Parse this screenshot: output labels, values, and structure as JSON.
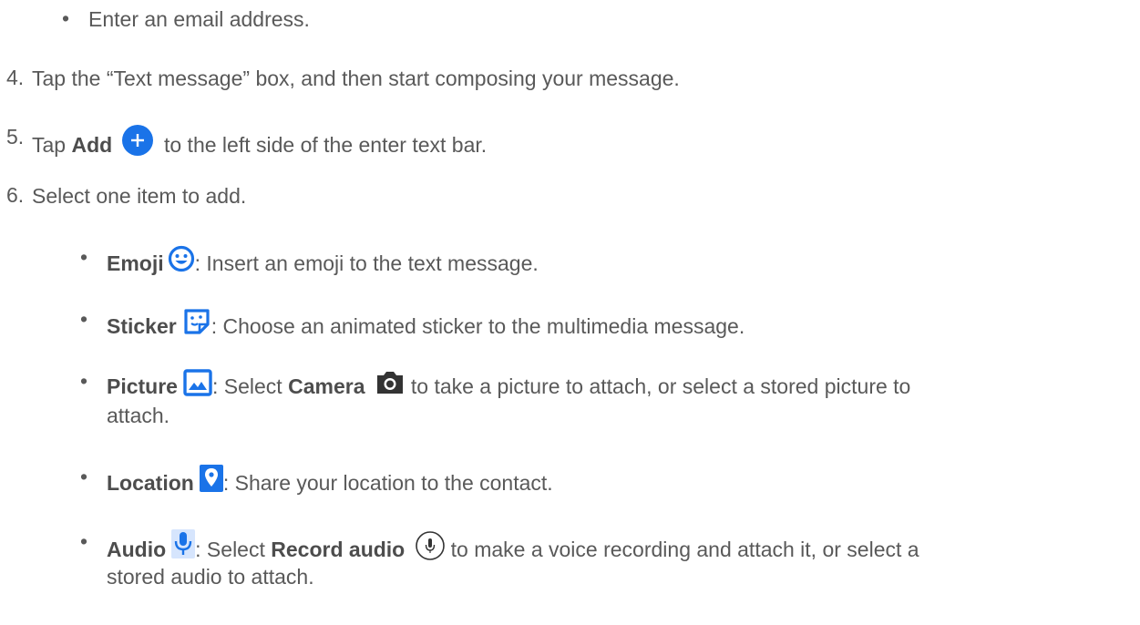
{
  "bullet_char": "•",
  "top_bullet": {
    "text": "Enter an email address."
  },
  "steps": [
    {
      "num": "4.",
      "text": "Tap the “Text message” box, and then start composing your message."
    },
    {
      "num": "5.",
      "pre": "Tap ",
      "bold": "Add",
      "icon": "add-circle-icon",
      "post": "to the left side of the enter text bar."
    },
    {
      "num": "6.",
      "text": "Select one item to add."
    }
  ],
  "items": [
    {
      "bold": "Emoji",
      "icon": "emoji-icon",
      "text": ": Insert an emoji to the text message."
    },
    {
      "bold": "Sticker",
      "icon": "sticker-icon",
      "text": ": Choose an animated sticker to the multimedia message."
    },
    {
      "bold": "Picture",
      "icon": "picture-icon",
      "text_a": ": Select ",
      "bold2": "Camera",
      "icon2": "camera-icon",
      "text_b": "to take a picture to attach, or select a stored picture to",
      "text_c": "attach."
    },
    {
      "bold": "Location",
      "icon": "location-icon",
      "text": ": Share your location to the contact."
    },
    {
      "bold": "Audio",
      "icon": "microphone-icon",
      "text_a": ": Select ",
      "bold2": "Record audio",
      "icon2": "record-audio-icon",
      "text_b": "to make a voice recording and attach it, or select a",
      "text_c": "stored audio to attach."
    }
  ],
  "colors": {
    "text": "#595959",
    "icon_blue": "#1a73e8",
    "icon_dark": "#333333"
  }
}
